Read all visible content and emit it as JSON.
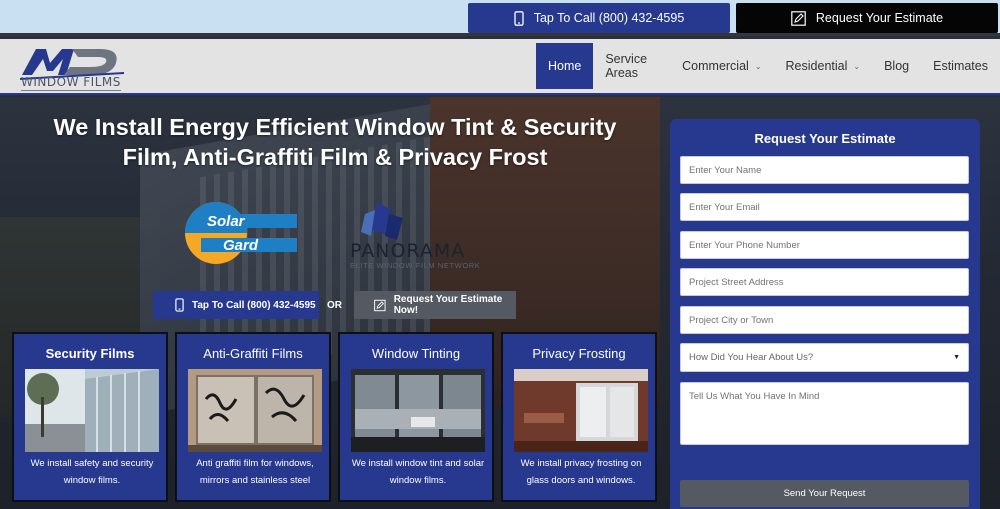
{
  "topbar": {
    "call_label": "Tap To Call (800) 432-4595",
    "estimate_label": "Request Your Estimate"
  },
  "logo": {
    "mark": "MD",
    "sub": "WINDOW FILMS"
  },
  "nav": {
    "items": [
      {
        "label": "Home",
        "active": true
      },
      {
        "label": "Service Areas"
      },
      {
        "label": "Commercial",
        "dropdown": true
      },
      {
        "label": "Residential",
        "dropdown": true
      },
      {
        "label": "Blog"
      },
      {
        "label": "Estimates"
      }
    ]
  },
  "hero": {
    "title_line1": "We Install Energy Efficient Window Tint & Security",
    "title_line2": "Film, Anti-Graffiti Film & Privacy Frost",
    "partner1": {
      "line1": "Solar",
      "line2": "Gard"
    },
    "partner2": {
      "name": "PANORAMA",
      "sub": "ELITE WINDOW FILM NETWORK"
    },
    "cta_call": "Tap To Call (800) 432-4595",
    "cta_or": "OR",
    "cta_estimate": "Request Your Estimate Now!"
  },
  "cards": [
    {
      "title": "Security Films",
      "desc": "We install safety and security window films."
    },
    {
      "title": "Anti-Graffiti Films",
      "desc": "Anti graffiti film for windows, mirrors and stainless steel"
    },
    {
      "title": "Window Tinting",
      "desc": "We install window tint and solar window films."
    },
    {
      "title": "Privacy Frosting",
      "desc": "We install privacy frosting on glass doors and windows."
    }
  ],
  "form": {
    "title": "Request Your Estimate",
    "name_placeholder": "Enter Your Name",
    "email_placeholder": "Enter Your Email",
    "phone_placeholder": "Enter Your Phone Number",
    "street_placeholder": "Project Street Address",
    "city_placeholder": "Project City or Town",
    "hear_selected": "How Did You Hear About Us?",
    "message_placeholder": "Tell Us What You Have In Mind",
    "submit_label": "Send Your Request"
  },
  "colors": {
    "brand_blue": "#27388f",
    "dark": "#050505",
    "gray_button": "#555a62",
    "topbar_bg": "#c9dff2",
    "header_bg": "#e3e3e3"
  },
  "icons": [
    "phone-icon",
    "edit-icon",
    "chevron-down-icon"
  ]
}
